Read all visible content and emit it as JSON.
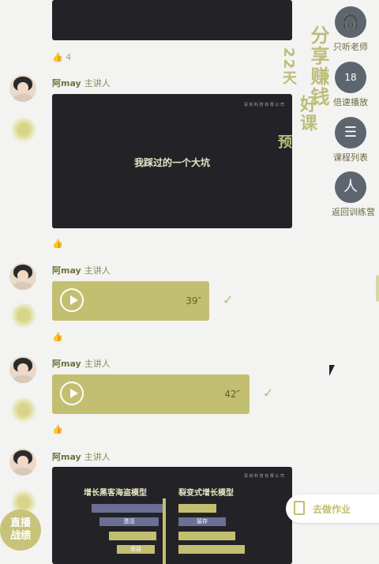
{
  "top_card_like_count": "4",
  "side_menu": [
    {
      "label": "只听老师",
      "icon": "headphones-icon",
      "glyph": "🎧"
    },
    {
      "label": "倍速播放",
      "icon": "calendar-speed-icon",
      "glyph": "18"
    },
    {
      "label": "课程列表",
      "icon": "list-icon",
      "glyph": "☰"
    },
    {
      "label": "返回训练营",
      "icon": "return-camp-icon",
      "glyph": "人"
    }
  ],
  "overlay_text": {
    "a": "分享赚钱",
    "b": "22天",
    "c": "好课",
    "d": "预"
  },
  "messages": [
    {
      "speaker": "阿may",
      "role": "主讲人",
      "type": "image",
      "card_title": "我踩过的一个大坑",
      "card_brand": "深 圳 科 技 有 限 公 司"
    },
    {
      "speaker": "阿may",
      "role": "主讲人",
      "type": "audio",
      "duration": "39″",
      "status": "✓"
    },
    {
      "speaker": "阿may",
      "role": "主讲人",
      "type": "audio",
      "duration": "42″",
      "status": "✓"
    },
    {
      "speaker": "阿may",
      "role": "主讲人",
      "type": "image",
      "left_title": "增长黑客海盗模型",
      "right_title": "裂变式增长模型",
      "card_brand": "深 圳 科 技 有 限 公 司",
      "left_steps": [
        "",
        "激活",
        "",
        "收益"
      ],
      "right_steps": [
        "",
        "留存",
        "",
        ""
      ]
    }
  ],
  "homework_label": "去做作业",
  "bottom_badge": {
    "line1": "直播",
    "line2": "战绩"
  }
}
